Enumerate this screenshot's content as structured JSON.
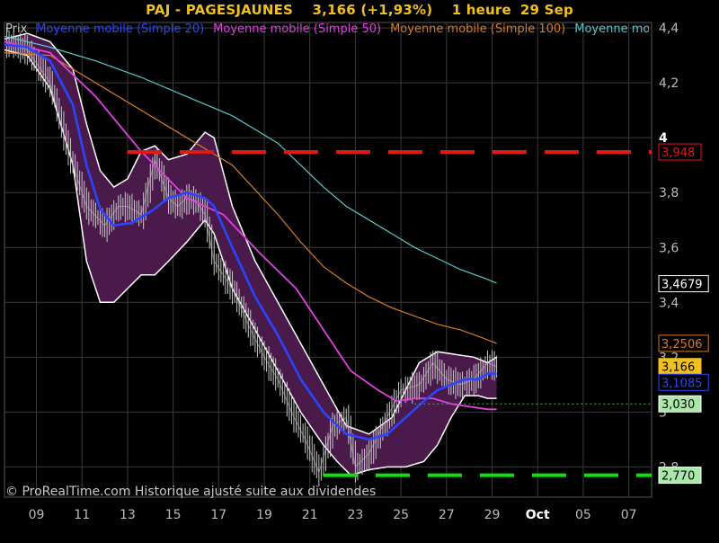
{
  "title": {
    "symbol": "PAJ - PAGESJAUNES",
    "quote": "3,166 (+1,93%)",
    "period": "1 heure",
    "date": "29 Sep"
  },
  "watermark": "© ProRealTime.com Historique ajusté suite aux dividendes",
  "colors": {
    "background": "#000000",
    "title": "#f0c020",
    "price": "#c8c8c8",
    "sma20": "#2a45ff",
    "sma50": "#e040e0",
    "sma100": "#d87a20",
    "sma200": "#58c8c8",
    "bollinger_fill": "#4a1a4a",
    "bollinger_edge": "#ffffff",
    "resistance": "#e01818",
    "support": "#10e010",
    "grid": "#3a3a3a"
  },
  "chart_data": {
    "type": "line",
    "legend": [
      {
        "label": "Prix",
        "color": "#c8c8c8"
      },
      {
        "label": "Moyenne mobile (Simple 20)",
        "color": "#2a45ff"
      },
      {
        "label": "Moyenne mobile (Simple 50)",
        "color": "#e040e0"
      },
      {
        "label": "Moyenne mobile (Simple 100)",
        "color": "#d87a20"
      },
      {
        "label": "Moyenne mobile (Simple 200)",
        "color": "#58c8c8"
      }
    ],
    "x_ticks": [
      "09",
      "11",
      "13",
      "15",
      "17",
      "19",
      "21",
      "23",
      "25",
      "27",
      "29",
      "Oct",
      "05",
      "07"
    ],
    "x_domain": [
      0,
      142
    ],
    "x_tick_positions": [
      7,
      17,
      27,
      37,
      47,
      57,
      67,
      77,
      87,
      97,
      107,
      117,
      127,
      137
    ],
    "y_ticks": [
      "2,8",
      "3",
      "3,2",
      "3,4",
      "3,6",
      "3,8",
      "4",
      "4,2",
      "4,4"
    ],
    "ylim": [
      2.69,
      4.42
    ],
    "y_tick_values": [
      2.8,
      3.0,
      3.2,
      3.4,
      3.6,
      3.8,
      4.0,
      4.2,
      4.4
    ],
    "price": {
      "x": [
        0,
        5,
        10,
        14,
        18,
        22,
        25,
        27,
        30,
        33,
        36,
        38,
        40,
        42,
        44,
        46,
        50,
        54,
        57,
        60,
        63,
        66,
        69,
        72,
        75,
        77,
        80,
        83,
        87,
        91,
        94,
        97,
        100,
        103,
        106,
        108
      ],
      "y": [
        4.35,
        4.32,
        4.2,
        3.95,
        3.75,
        3.68,
        3.75,
        3.75,
        3.72,
        3.92,
        3.78,
        3.75,
        3.78,
        3.77,
        3.72,
        3.55,
        3.45,
        3.3,
        3.2,
        3.12,
        3.0,
        2.9,
        2.78,
        2.95,
        2.98,
        2.8,
        2.85,
        2.95,
        3.08,
        3.1,
        3.18,
        3.12,
        3.1,
        3.12,
        3.18,
        3.166
      ]
    },
    "bollinger_upper": {
      "x": [
        0,
        5,
        10,
        15,
        18,
        21,
        24,
        27,
        30,
        33,
        36,
        40,
        44,
        46,
        50,
        55,
        60,
        65,
        70,
        75,
        80,
        85,
        88,
        91,
        95,
        99,
        103,
        106,
        108
      ],
      "y": [
        4.36,
        4.38,
        4.35,
        4.25,
        4.05,
        3.88,
        3.82,
        3.85,
        3.95,
        3.97,
        3.92,
        3.94,
        4.02,
        4.0,
        3.75,
        3.55,
        3.4,
        3.25,
        3.1,
        2.95,
        2.92,
        2.98,
        3.08,
        3.18,
        3.22,
        3.21,
        3.2,
        3.18,
        3.2
      ]
    },
    "bollinger_lower": {
      "x": [
        0,
        5,
        10,
        15,
        18,
        21,
        24,
        27,
        30,
        33,
        36,
        40,
        44,
        46,
        50,
        55,
        60,
        65,
        70,
        73,
        76,
        80,
        84,
        88,
        92,
        95,
        98,
        101,
        104,
        106,
        108
      ],
      "y": [
        4.32,
        4.3,
        4.18,
        3.9,
        3.55,
        3.4,
        3.4,
        3.45,
        3.5,
        3.5,
        3.55,
        3.62,
        3.7,
        3.65,
        3.45,
        3.3,
        3.15,
        3.0,
        2.88,
        2.82,
        2.77,
        2.79,
        2.8,
        2.8,
        2.82,
        2.88,
        2.98,
        3.06,
        3.06,
        3.05,
        3.05
      ]
    },
    "sma20": {
      "x": [
        0,
        5,
        10,
        15,
        18,
        21,
        24,
        28,
        32,
        36,
        40,
        44,
        46,
        50,
        55,
        60,
        65,
        70,
        75,
        80,
        84,
        88,
        92,
        95,
        98,
        101,
        104,
        106,
        108
      ],
      "y": [
        4.34,
        4.33,
        4.28,
        4.12,
        3.9,
        3.74,
        3.68,
        3.69,
        3.73,
        3.78,
        3.8,
        3.78,
        3.75,
        3.6,
        3.42,
        3.28,
        3.12,
        3.0,
        2.92,
        2.9,
        2.92,
        2.98,
        3.04,
        3.08,
        3.1,
        3.12,
        3.12,
        3.14,
        3.14
      ]
    },
    "sma50": {
      "x": [
        0,
        10,
        20,
        30,
        40,
        48,
        56,
        64,
        70,
        76,
        82,
        86,
        90,
        94,
        98,
        102,
        106,
        108
      ],
      "y": [
        4.35,
        4.31,
        4.15,
        3.95,
        3.78,
        3.72,
        3.58,
        3.45,
        3.3,
        3.15,
        3.08,
        3.04,
        3.05,
        3.05,
        3.03,
        3.02,
        3.01,
        3.01
      ]
    },
    "sma100": {
      "x": [
        0,
        10,
        20,
        30,
        40,
        50,
        55,
        60,
        65,
        70,
        75,
        80,
        85,
        90,
        95,
        100,
        105,
        108
      ],
      "y": [
        4.31,
        4.3,
        4.2,
        4.1,
        4.0,
        3.9,
        3.81,
        3.72,
        3.62,
        3.53,
        3.47,
        3.42,
        3.38,
        3.35,
        3.32,
        3.3,
        3.27,
        3.25
      ]
    },
    "sma200": {
      "x": [
        0,
        10,
        20,
        30,
        40,
        50,
        55,
        60,
        65,
        70,
        75,
        80,
        85,
        90,
        95,
        100,
        105,
        108
      ],
      "y": [
        4.37,
        4.33,
        4.28,
        4.22,
        4.15,
        4.08,
        4.03,
        3.98,
        3.9,
        3.82,
        3.75,
        3.7,
        3.65,
        3.6,
        3.56,
        3.52,
        3.49,
        3.47
      ]
    },
    "horizontal_lines": [
      {
        "name": "resistance",
        "value": 3.948,
        "x_start": 27,
        "color": "#e01818"
      },
      {
        "name": "support",
        "value": 2.77,
        "x_start": 70,
        "color": "#10e010"
      },
      {
        "name": "dotted",
        "value": 3.03,
        "x_start": 90,
        "color": "#10e010"
      }
    ],
    "value_labels": [
      {
        "text": "3,948",
        "value": 3.948,
        "bg": "#000000",
        "fg": "#e01818",
        "border": "#e01818"
      },
      {
        "text": "3,4679",
        "value": 3.4679,
        "bg": "#000000",
        "fg": "#ffffff",
        "border": "#ffffff"
      },
      {
        "text": "3,2506",
        "value": 3.2506,
        "bg": "#000000",
        "fg": "#d87a20",
        "border": "#d87a20"
      },
      {
        "text": "3,166",
        "value": 3.166,
        "bg": "#f0c020",
        "fg": "#000000",
        "border": "#f0c020"
      },
      {
        "text": "3,1085",
        "value": 3.1085,
        "bg": "#000000",
        "fg": "#2a45ff",
        "border": "#2a45ff"
      },
      {
        "text": "3,030",
        "value": 3.03,
        "bg": "#a8e8a8",
        "fg": "#000000",
        "border": "#ffffff"
      },
      {
        "text": "2,770",
        "value": 2.77,
        "bg": "#a8e8a8",
        "fg": "#000000",
        "border": "#ffffff"
      }
    ]
  }
}
